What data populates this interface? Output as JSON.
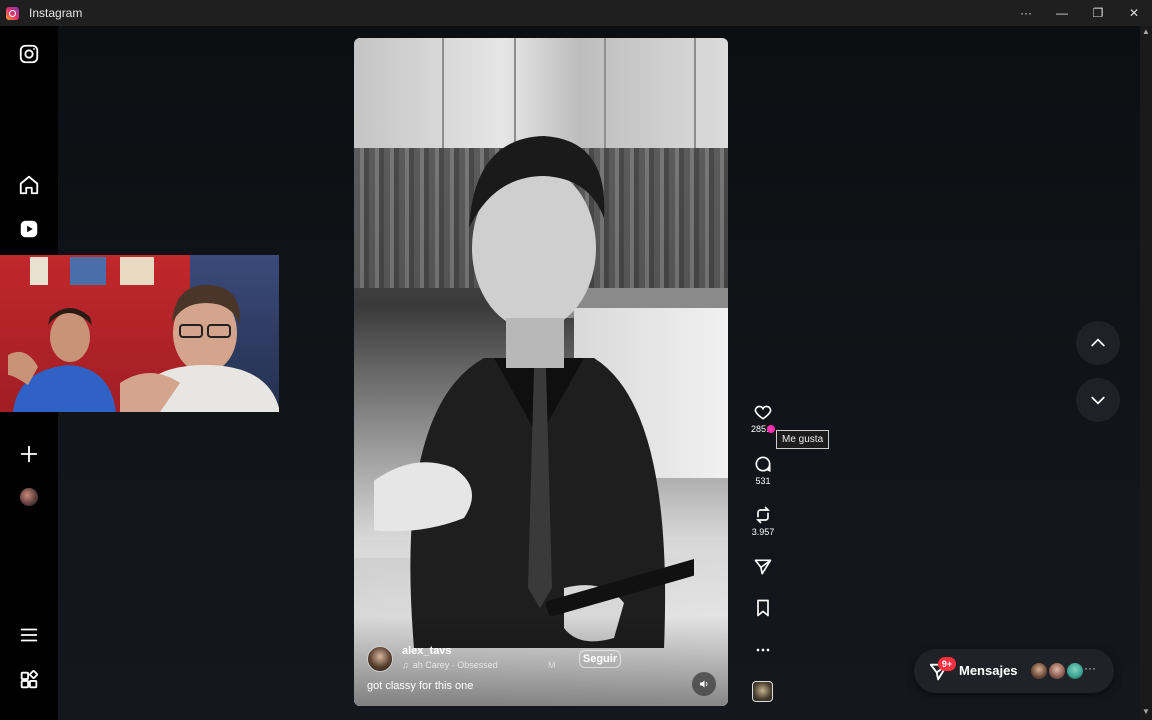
{
  "window": {
    "title": "Instagram",
    "controls": {
      "more": "···",
      "minimize": "—",
      "restore": "❐",
      "close": "✕"
    }
  },
  "sidebar": {
    "items": [
      {
        "name": "instagram-logo-icon",
        "icon": "instagram"
      },
      {
        "name": "home-icon",
        "icon": "home"
      },
      {
        "name": "reels-icon",
        "icon": "reels"
      },
      {
        "name": "create-icon",
        "icon": "plus"
      },
      {
        "name": "profile-avatar",
        "icon": "avatar"
      },
      {
        "name": "menu-icon",
        "icon": "hamburger"
      },
      {
        "name": "apps-icon",
        "icon": "grid"
      }
    ]
  },
  "reel": {
    "username": "alex_tavs",
    "music": "ah Carey · Obsessed",
    "music_extra": "M",
    "follow_label": "Seguir",
    "caption": "got classy for this one"
  },
  "actions": {
    "likes": "285",
    "likes_suffix": "…",
    "comments": "531",
    "reposts": "3.957",
    "tooltip": "Me gusta"
  },
  "messages": {
    "label": "Mensajes",
    "badge": "9+",
    "more": "···"
  },
  "colors": {
    "accent_badge": "#ff3040",
    "cursor": "#ff2fb0",
    "panel": "#1f2327"
  }
}
